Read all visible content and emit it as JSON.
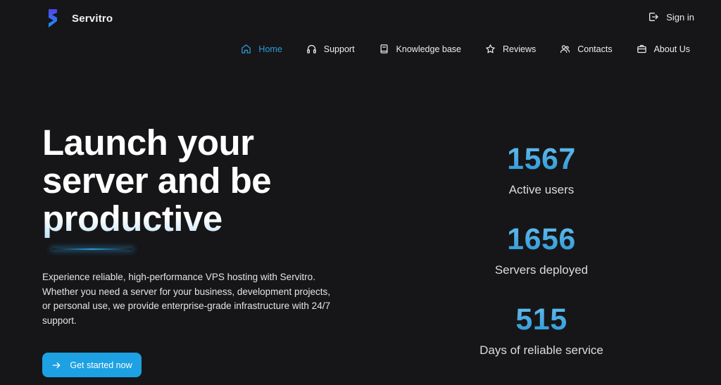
{
  "brand": {
    "name": "Servitro"
  },
  "header": {
    "signin_label": "Sign in"
  },
  "nav": [
    {
      "label": "Home",
      "icon": "home-icon",
      "active": true
    },
    {
      "label": "Support",
      "icon": "headphones-icon",
      "active": false
    },
    {
      "label": "Knowledge base",
      "icon": "book-icon",
      "active": false
    },
    {
      "label": "Reviews",
      "icon": "star-icon",
      "active": false
    },
    {
      "label": "Contacts",
      "icon": "users-icon",
      "active": false
    },
    {
      "label": "About Us",
      "icon": "briefcase-icon",
      "active": false
    }
  ],
  "hero": {
    "title_lines": [
      "Launch your",
      "server and be",
      "productive"
    ],
    "description": "Experience reliable, high-performance VPS hosting with Servitro. Whether you need a server for your business, development projects, or personal use, we provide enterprise-grade infrastructure with 24/7 support.",
    "cta_label": "Get started now"
  },
  "stats": [
    {
      "value": "1567",
      "label": "Active users"
    },
    {
      "value": "1656",
      "label": "Servers deployed"
    },
    {
      "value": "515",
      "label": "Days of reliable service"
    }
  ],
  "colors": {
    "background": "#161618",
    "accent": "#1da1e2",
    "active_nav": "#2d9cdb"
  }
}
